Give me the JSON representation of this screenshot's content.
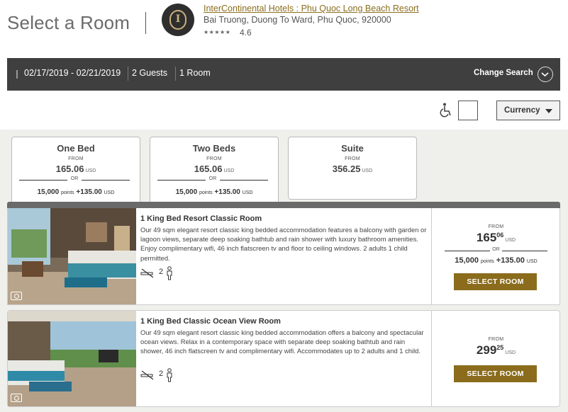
{
  "header": {
    "page_title": "Select a Room",
    "hotel_name": "InterContinental Hotels : Phu Quoc Long Beach Resort",
    "address": "Bai Truong, Duong To Ward, Phu Quoc, 920000",
    "stars": "★★★★★",
    "rating": "4.6",
    "logo_letter": "I"
  },
  "search_bar": {
    "dates": "02/17/2019 - 02/21/2019",
    "guests": "2 Guests",
    "rooms": "1 Room",
    "change_label": "Change Search",
    "chevron_icon": "chevron-down-icon"
  },
  "filters": {
    "accessible_icon": "wheelchair-icon",
    "currency_label": "Currency"
  },
  "tabs": [
    {
      "name": "One Bed",
      "from": "FROM",
      "price": "165.06",
      "unit": "USD",
      "or": "OR",
      "points": "15,000",
      "points_label": "points",
      "plus_cash": "+135.00",
      "cash_unit": "USD"
    },
    {
      "name": "Two Beds",
      "from": "FROM",
      "price": "165.06",
      "unit": "USD",
      "or": "OR",
      "points": "15,000",
      "points_label": "points",
      "plus_cash": "+135.00",
      "cash_unit": "USD"
    },
    {
      "name": "Suite",
      "from": "FROM",
      "price": "356.25",
      "unit": "USD"
    }
  ],
  "rooms": [
    {
      "title": "1 King Bed Resort Classic Room",
      "description": "Our 49 sqm elegant resort classic king bedded accommodation features a balcony with garden or lagoon views, separate deep soaking bathtub and rain shower with luxury bathroom amenities. Enjoy complimentary wifi, 46 inch flatscreen tv and floor to ceiling windows. 2 adults 1 child permitted.",
      "occupancy": "2",
      "from": "FROM",
      "price_int": "165",
      "price_dec": "06",
      "unit": "USD",
      "or": "OR",
      "points": "15,000",
      "points_label": "points",
      "plus_cash": "+135.00",
      "cash_unit": "USD",
      "button": "SELECT ROOM"
    },
    {
      "title": "1 King Bed Classic Ocean View Room",
      "description": "Our 49 sqm elegant resort classic king bedded accommodation offers a balcony and spectacular ocean views. Relax in a contemporary space with separate deep soaking bathtub and rain shower, 46 inch flatscreen tv and complimentary wifi. Accommodates up to 2 adults and 1 child.",
      "occupancy": "2",
      "from": "FROM",
      "price_int": "299",
      "price_dec": "25",
      "unit": "USD",
      "button": "SELECT ROOM"
    }
  ],
  "colors": {
    "brand_gold": "#8a6c1c",
    "link_gold": "#8a6d1d",
    "search_bar_bg": "#3f3f3f",
    "page_bg": "#efefec"
  }
}
